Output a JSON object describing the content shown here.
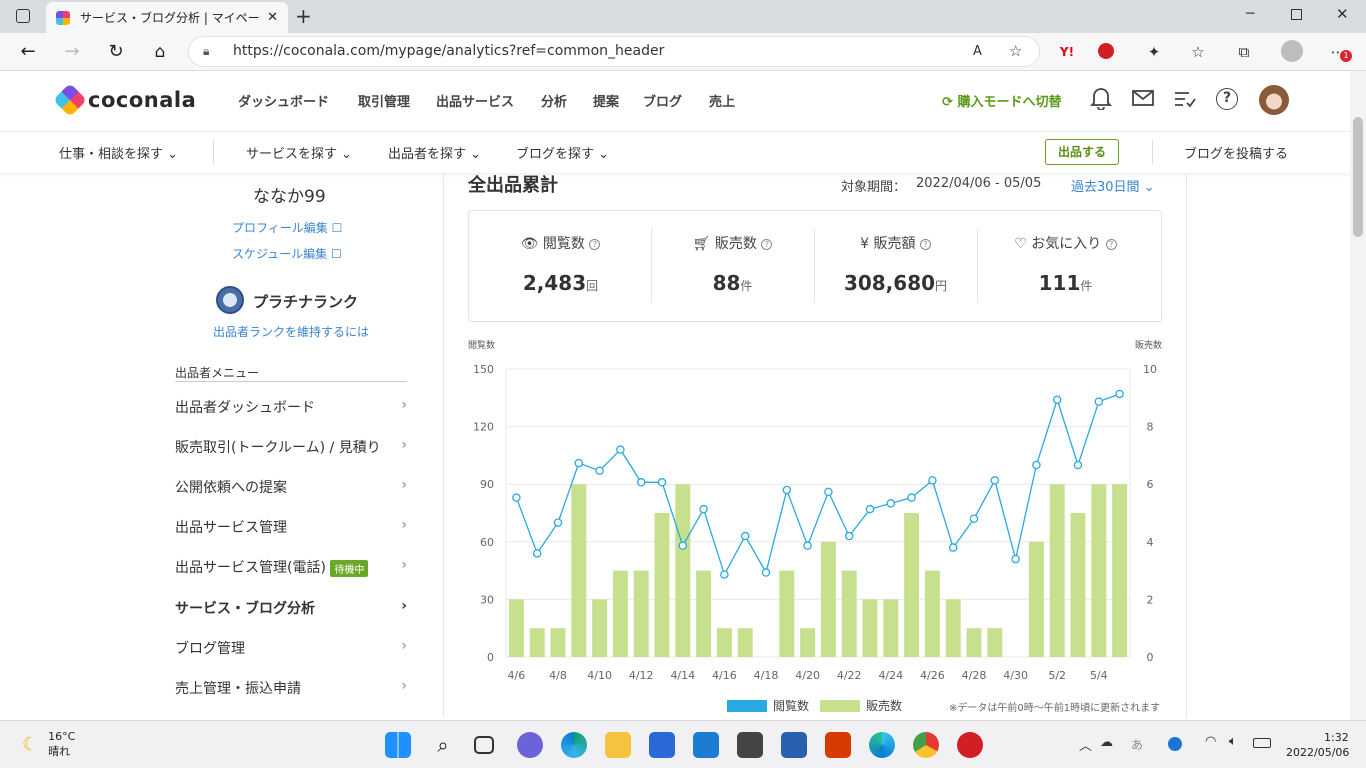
{
  "browser": {
    "tab_title": "サービス・ブログ分析 | マイページ | ココ",
    "url": "https://coconala.com/mypage/analytics?ref=common_header",
    "notification_badge": "1"
  },
  "header": {
    "logo": "coconala",
    "nav": [
      "ダッシュボード",
      "取引管理",
      "出品サービス",
      "分析",
      "提案",
      "ブログ",
      "売上"
    ],
    "mode_switch": "購入モードへ切替"
  },
  "subnav": {
    "items": [
      "仕事・相談を探す",
      "サービスを探す",
      "出品者を探す",
      "ブログを探す"
    ],
    "sell_button": "出品する",
    "post_blog": "ブログを投稿する"
  },
  "sidebar": {
    "username": "ななか99",
    "profile_edit": "プロフィール編集",
    "schedule_edit": "スケジュール編集",
    "rank": "プラチナランク",
    "rank_link": "出品者ランクを維持するには",
    "menu_title": "出品者メニュー",
    "menu": [
      {
        "label": "出品者ダッシュボード"
      },
      {
        "label": "販売取引(トークルーム) / 見積り"
      },
      {
        "label": "公開依頼への提案"
      },
      {
        "label": "出品サービス管理"
      },
      {
        "label": "出品サービス管理(電話)",
        "badge": "待機中"
      },
      {
        "label": "サービス・ブログ分析"
      },
      {
        "label": "ブログ管理"
      },
      {
        "label": "売上管理・振込申請"
      }
    ]
  },
  "main": {
    "title": "全出品累計",
    "period_label": "対象期間：",
    "period_value": "2022/04/06 - 05/05",
    "period_select": "過去30日間",
    "stats": [
      {
        "label": "閲覧数",
        "value": "2,483",
        "unit": "回",
        "icon": "eye-icon"
      },
      {
        "label": "販売数",
        "value": "88",
        "unit": "件",
        "icon": "cart-icon"
      },
      {
        "label": "販売額",
        "value": "308,680",
        "unit": "円",
        "icon": "yen-icon"
      },
      {
        "label": "お気に入り",
        "value": "111",
        "unit": "件",
        "icon": "heart-icon"
      }
    ],
    "chart_note": "※データは午前0時〜午前1時頃に更新されます"
  },
  "chart_data": {
    "type": "bar",
    "categories": [
      "4/6",
      "4/7",
      "4/8",
      "4/9",
      "4/10",
      "4/11",
      "4/12",
      "4/13",
      "4/14",
      "4/15",
      "4/16",
      "4/17",
      "4/18",
      "4/19",
      "4/20",
      "4/21",
      "4/22",
      "4/23",
      "4/24",
      "4/25",
      "4/26",
      "4/27",
      "4/28",
      "4/29",
      "4/30",
      "5/1",
      "5/2",
      "5/3",
      "5/4",
      "5/5"
    ],
    "tick_labels": [
      "4/6",
      "4/8",
      "4/10",
      "4/12",
      "4/14",
      "4/16",
      "4/18",
      "4/20",
      "4/22",
      "4/24",
      "4/26",
      "4/28",
      "4/30",
      "5/2",
      "5/4"
    ],
    "ylabel_left": "閲覧数",
    "ylabel_right": "販売数",
    "ylim_left": [
      0,
      150
    ],
    "yticks_left": [
      0,
      30,
      60,
      90,
      120,
      150
    ],
    "ylim_right": [
      0,
      10
    ],
    "yticks_right": [
      0,
      2,
      4,
      6,
      8,
      10
    ],
    "series": [
      {
        "name": "閲覧数",
        "type": "line",
        "axis": "left",
        "color": "#29a9e0",
        "values": [
          83,
          54,
          70,
          101,
          97,
          108,
          91,
          91,
          58,
          77,
          43,
          63,
          44,
          87,
          58,
          86,
          63,
          77,
          80,
          83,
          92,
          57,
          72,
          92,
          51,
          100,
          134,
          100,
          133,
          137
        ]
      },
      {
        "name": "販売数",
        "type": "bar",
        "axis": "right",
        "color": "#c6e08e",
        "values": [
          2,
          1,
          1,
          6,
          2,
          3,
          3,
          5,
          6,
          3,
          1,
          1,
          0,
          3,
          1,
          4,
          3,
          2,
          2,
          5,
          3,
          2,
          1,
          1,
          0,
          4,
          6,
          5,
          6,
          6
        ]
      }
    ],
    "grid": true,
    "legend": "bottom-center"
  },
  "taskbar": {
    "weather_temp": "16°C",
    "weather_desc": "晴れ",
    "time": "1:32",
    "date": "2022/05/06",
    "ime": "あ"
  }
}
